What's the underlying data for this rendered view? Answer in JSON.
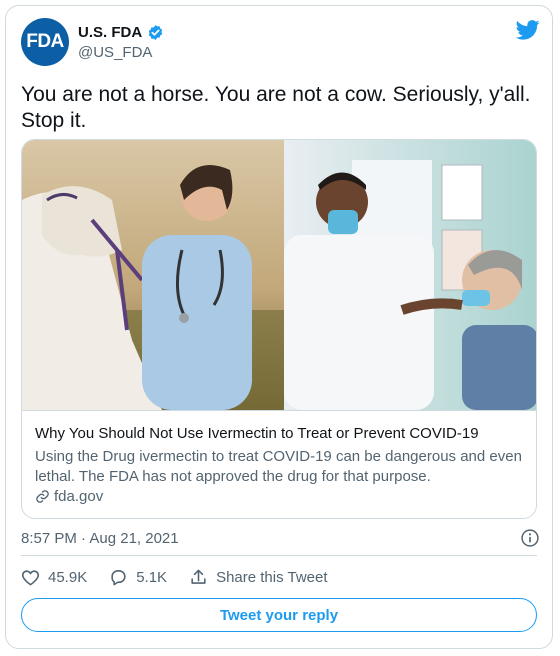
{
  "account": {
    "avatar_text": "FDA",
    "display_name": "U.S. FDA",
    "handle": "@US_FDA",
    "verified": true
  },
  "tweet": {
    "text": "You are not a horse. You are not a cow. Seriously, y'all. Stop it.",
    "timestamp": "8:57 PM · Aug 21, 2021"
  },
  "link_card": {
    "title": "Why You Should Not Use Ivermectin to Treat or Prevent COVID-19",
    "description": "Using the Drug ivermectin to treat COVID-19 can be dangerous and even lethal. The FDA has not approved the drug for that purpose.",
    "domain": "fda.gov"
  },
  "actions": {
    "likes": "45.9K",
    "replies": "5.1K",
    "share_label": "Share this Tweet"
  },
  "reply_button_label": "Tweet your reply",
  "colors": {
    "accent": "#1d9bf0",
    "fda_blue": "#0c5ea5",
    "secondary_text": "#536471"
  }
}
